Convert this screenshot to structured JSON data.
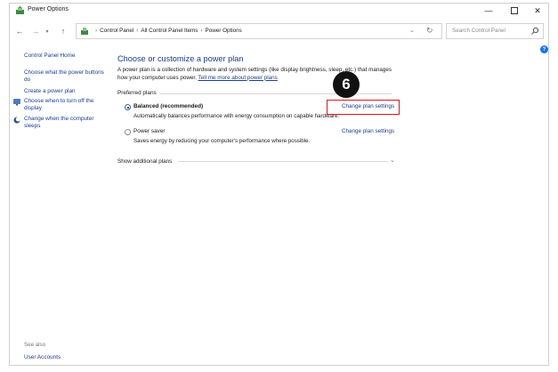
{
  "window": {
    "title": "Power Options"
  },
  "address": {
    "crumbs": [
      "Control Panel",
      "All Control Panel Items",
      "Power Options"
    ],
    "search_placeholder": "Search Control Panel"
  },
  "sidebar": {
    "home": "Control Panel Home",
    "links": [
      {
        "label": "Choose what the power buttons do",
        "icon": null
      },
      {
        "label": "Create a power plan",
        "icon": null
      },
      {
        "label": "Choose when to turn off the display",
        "icon": "monitor-icon"
      },
      {
        "label": "Change when the computer sleeps",
        "icon": "moon-icon"
      }
    ],
    "see_also": "See also",
    "user_accounts": "User Accounts"
  },
  "main": {
    "heading": "Choose or customize a power plan",
    "description": "A power plan is a collection of hardware and system settings (like display brightness, sleep, etc.) that manages how your computer uses power.",
    "tell_more": "Tell me more about power plans",
    "preferred_title": "Preferred plans",
    "plans": [
      {
        "name": "Balanced (recommended)",
        "selected": true,
        "description": "Automatically balances performance with energy consumption on capable hardware.",
        "link": "Change plan settings"
      },
      {
        "name": "Power saver",
        "selected": false,
        "description": "Saves energy by reducing your computer's performance where possible.",
        "link": "Change plan settings"
      }
    ],
    "show_more": "Show additional plans"
  },
  "annotation": {
    "step": "6",
    "color": "#e0151b"
  }
}
